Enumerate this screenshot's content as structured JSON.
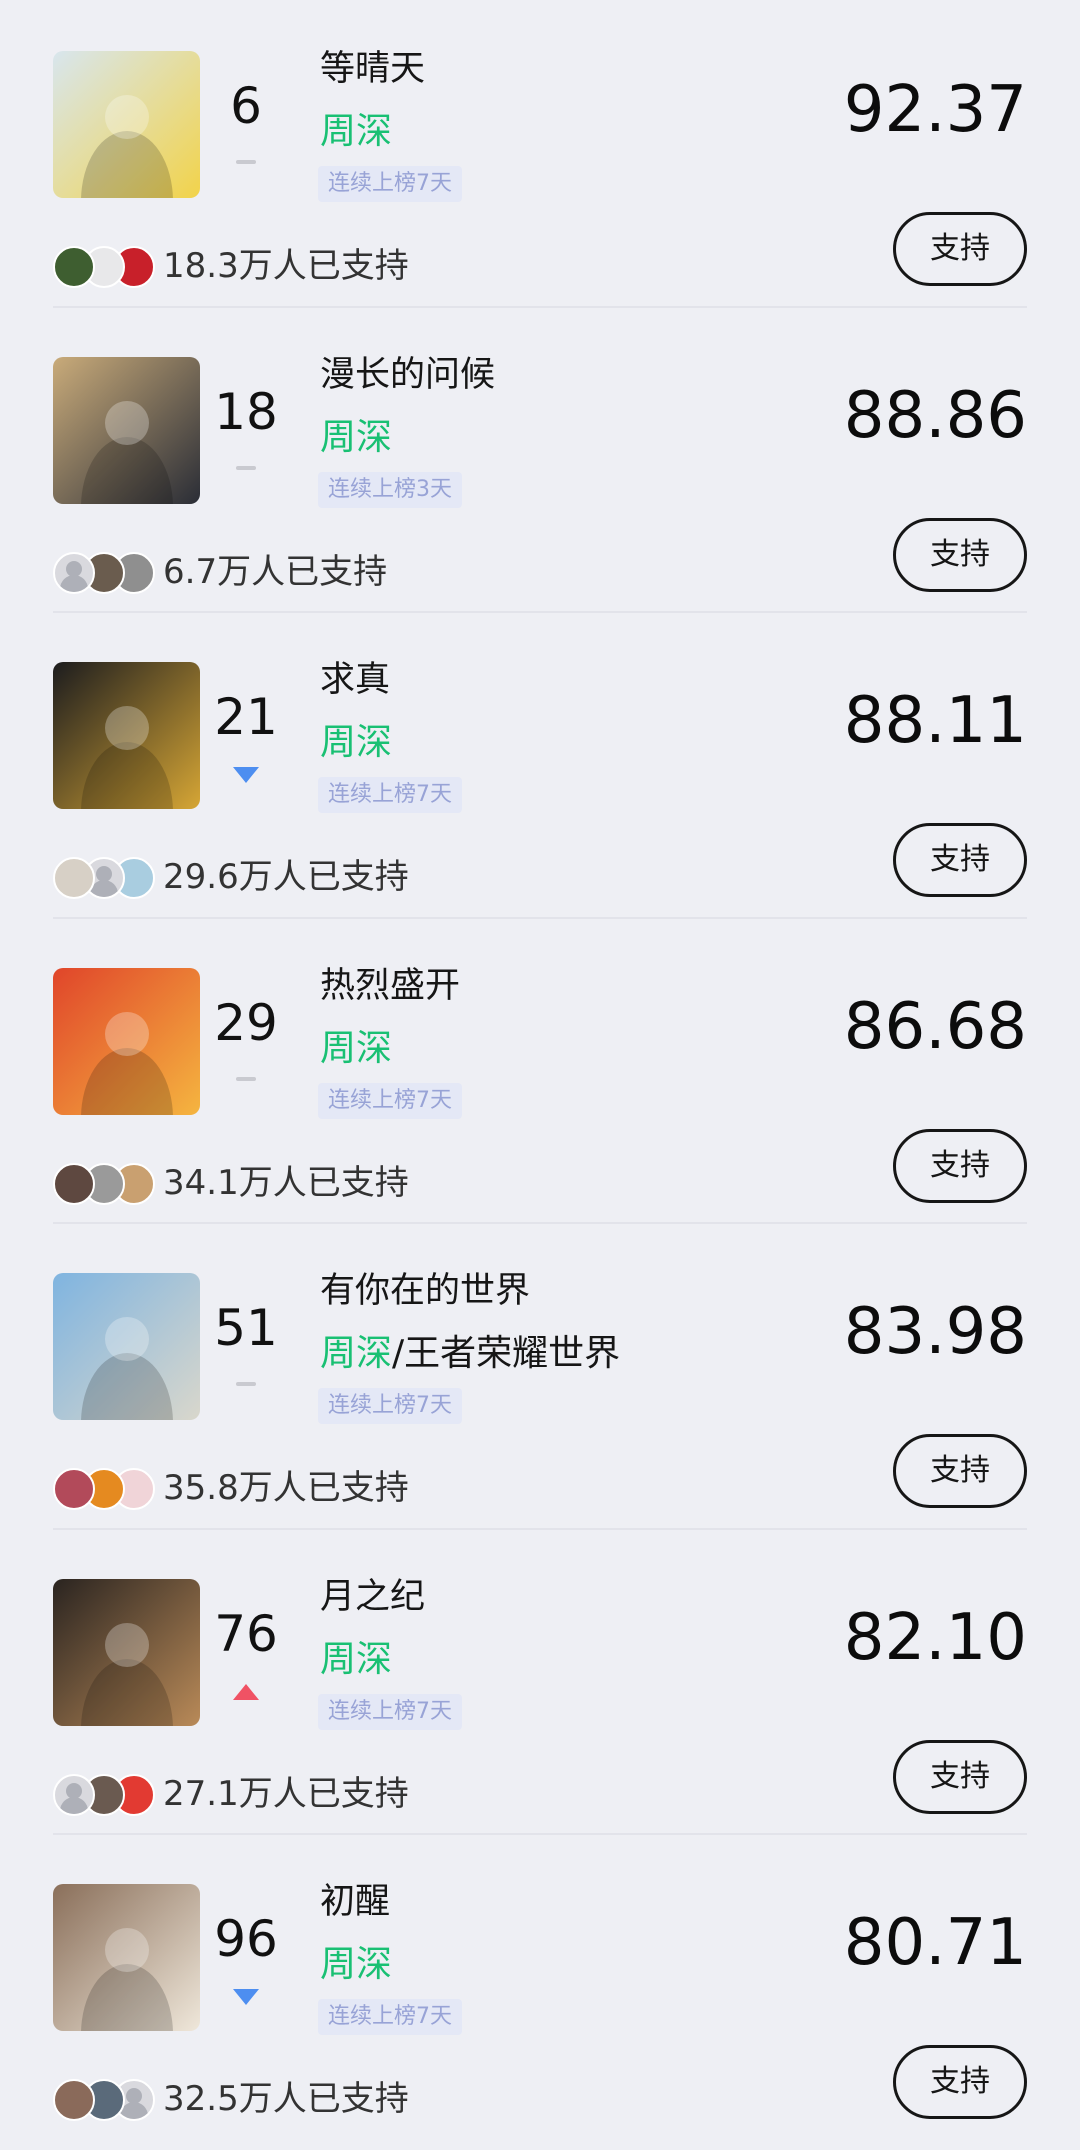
{
  "entries": [
    {
      "rank": "6",
      "trend": "flat",
      "title": "等晴天",
      "artists": [
        "周深"
      ],
      "artist_sep": "",
      "streak": "连续上榜7天",
      "score": "92.37",
      "supporters": "18.3万人已支持",
      "support_label": "支持",
      "cover_colors": [
        "#d8e6ee",
        "#f2d34a"
      ],
      "avatar_colors": [
        "#3e5e30",
        "#e8e8ea",
        "#c8202a"
      ]
    },
    {
      "rank": "18",
      "trend": "flat",
      "title": "漫长的问候",
      "artists": [
        "周深"
      ],
      "artist_sep": "",
      "streak": "连续上榜3天",
      "score": "88.86",
      "supporters": "6.7万人已支持",
      "support_label": "支持",
      "cover_colors": [
        "#c9ab7a",
        "#2a2d36"
      ],
      "avatar_colors": [
        "blank",
        "#6a5c4e",
        "#8f8f8f"
      ]
    },
    {
      "rank": "21",
      "trend": "down",
      "title": "求真",
      "artists": [
        "周深"
      ],
      "artist_sep": "",
      "streak": "连续上榜7天",
      "score": "88.11",
      "supporters": "29.6万人已支持",
      "support_label": "支持",
      "cover_colors": [
        "#1c1c1e",
        "#d6a635"
      ],
      "avatar_colors": [
        "#d7d0c6",
        "blank",
        "#a9cde0"
      ]
    },
    {
      "rank": "29",
      "trend": "flat",
      "title": "热烈盛开",
      "artists": [
        "周深"
      ],
      "artist_sep": "",
      "streak": "连续上榜7天",
      "score": "86.68",
      "supporters": "34.1万人已支持",
      "support_label": "支持",
      "cover_colors": [
        "#e0452a",
        "#f5b540"
      ],
      "avatar_colors": [
        "#5e4840",
        "#9a9a9a",
        "#c9a070"
      ]
    },
    {
      "rank": "51",
      "trend": "flat",
      "title": "有你在的世界",
      "artists": [
        "周深",
        "王者荣耀世界"
      ],
      "artist_sep": "/",
      "streak": "连续上榜7天",
      "score": "83.98",
      "supporters": "35.8万人已支持",
      "support_label": "支持",
      "cover_colors": [
        "#7fb4e0",
        "#d9d7cc"
      ],
      "avatar_colors": [
        "#b24a5a",
        "#e58a20",
        "#f0d4d8"
      ]
    },
    {
      "rank": "76",
      "trend": "up",
      "title": "月之纪",
      "artists": [
        "周深"
      ],
      "artist_sep": "",
      "streak": "连续上榜7天",
      "score": "82.10",
      "supporters": "27.1万人已支持",
      "support_label": "支持",
      "cover_colors": [
        "#2a2420",
        "#b98a58"
      ],
      "avatar_colors": [
        "blank",
        "#6a5a50",
        "#e23a32"
      ]
    },
    {
      "rank": "96",
      "trend": "down",
      "title": "初醒",
      "artists": [
        "周深"
      ],
      "artist_sep": "",
      "streak": "连续上榜7天",
      "score": "80.71",
      "supporters": "32.5万人已支持",
      "support_label": "支持",
      "cover_colors": [
        "#8a6f5a",
        "#efe7da"
      ],
      "avatar_colors": [
        "#8a6a5a",
        "#5a6a7a",
        "blank"
      ]
    }
  ]
}
